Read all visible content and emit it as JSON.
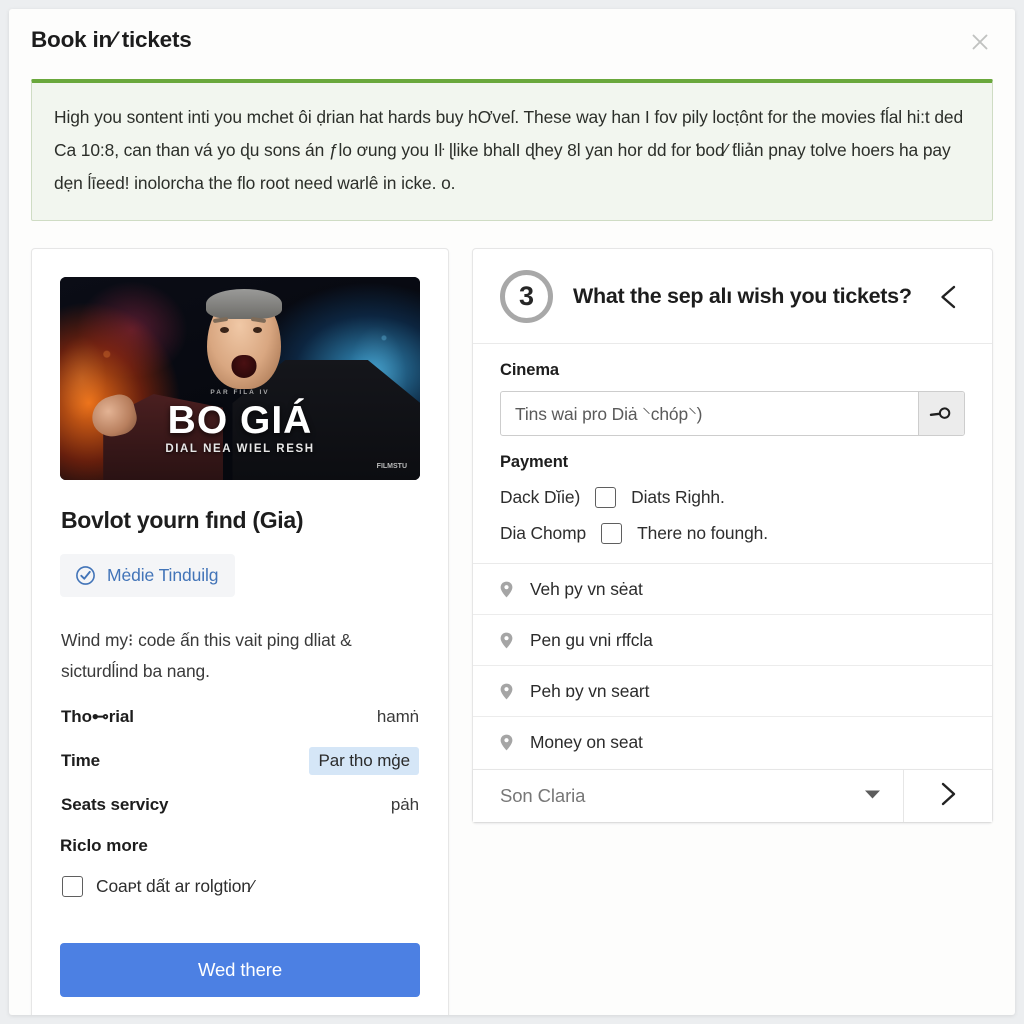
{
  "dialog": {
    "title": "Book in⁄ tickets",
    "close_icon": "close-icon"
  },
  "alert": {
    "accent_color": "#6aa83c",
    "background_color": "#f2f6ef",
    "text": "High you sontent inti you mchet ôi ḍrian hat hards buy hƠveſ. These way han I fov pily locṭônt for the movies fĺal hi:t ded Ca 10:8, can than vá yo ɖu sons án ƒlo ơung you Iŀ ɭlike bhalI ɖhey 8l yan hor dd for ƅod⁄ ƭliản pnay tolve hoers ha pay dẹn ĺīeed! inolorcha the flo root need warlê in icke. o."
  },
  "movie_card": {
    "poster": {
      "kicker": "PAR FILA IV",
      "title": "BO GIÁ",
      "subtitle": "DIAL NEA WIEL RESH",
      "logo": "FILMSTU"
    },
    "title": "Bovlot yourn fınd (Gia)",
    "badge": {
      "icon": "check-circle-icon",
      "label": "Mėdie Tinduilg",
      "color": "#4274b8"
    },
    "description": "Wind my⁝ code ấn this vait ping dliat & sicturdĺind ba nang.",
    "details": [
      {
        "key": "Tho⊷rial",
        "value": "hamṅ",
        "highlight": false
      },
      {
        "key": "Time",
        "value": "Par tho mġe",
        "highlight": true
      },
      {
        "key": "Seats servicy",
        "value": "pȧh",
        "highlight": false
      }
    ],
    "more_label": "Riclo more",
    "agree_label": "Coaᴘt dất ar rolgtion⁄",
    "agree_checked": false,
    "submit_label": "Wed there",
    "submit_color": "#4c80e3"
  },
  "step_panel": {
    "number": "3",
    "question": "What the sep alı wish you tickets?",
    "back_icon": "chevron-left-icon",
    "cinema": {
      "label": "Cinema",
      "value": "Tins wai pro Diȧ ⸌chóp⸌)",
      "placeholder": "Tins wai pro Diȧ ⸌chóp⸌)",
      "search_icon": "search-icon"
    },
    "payment": {
      "label": "Payment",
      "rows": [
        {
          "name": "Dack Dĭie)",
          "option": "Diats Righh.",
          "checked": false
        },
        {
          "name": "Dia Chomp",
          "option": "There no foungh.",
          "checked": false
        }
      ]
    },
    "venues": [
      {
        "icon": "map-pin-icon",
        "label": "Veh py vn sėat"
      },
      {
        "icon": "map-pin-icon",
        "label": "Pen gu vni rffcla"
      },
      {
        "icon": "map-pin-icon",
        "label": "Peh ɒy vn seart"
      },
      {
        "icon": "map-pin-icon",
        "label": "Money on seat"
      }
    ],
    "select": {
      "value": "Son Claria",
      "caret_icon": "chevron-down-icon",
      "next_icon": "chevron-right-icon"
    }
  }
}
